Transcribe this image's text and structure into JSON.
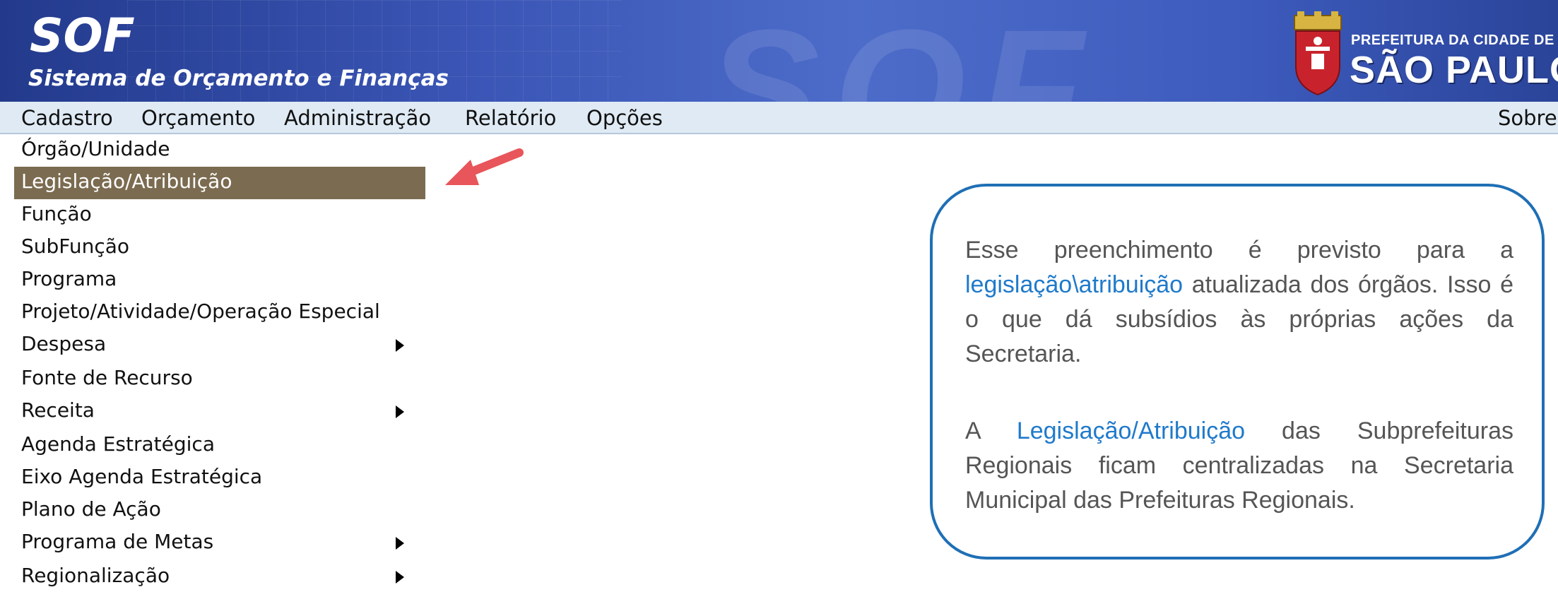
{
  "header": {
    "app_name": "SOF",
    "app_subtitle": "Sistema de Orçamento e Finanças",
    "watermark": "SOF",
    "logo": {
      "line1": "PREFEITURA DA CIDADE DE",
      "line2": "SÃO PAULO",
      "icon": "city-coat-of-arms-icon"
    }
  },
  "menubar": {
    "items": [
      "Cadastro",
      "Orçamento",
      "Administração",
      "Relatório",
      "Opções"
    ],
    "right_item": "Sobre"
  },
  "dropdown": {
    "items": [
      {
        "label": "Órgão/Unidade",
        "submenu": false
      },
      {
        "label": "Legislação/Atribuição",
        "submenu": false,
        "highlighted": true
      },
      {
        "label": "Função",
        "submenu": false
      },
      {
        "label": "SubFunção",
        "submenu": false
      },
      {
        "label": "Programa",
        "submenu": false
      },
      {
        "label": "Projeto/Atividade/Operação Especial",
        "submenu": false
      },
      {
        "label": "Despesa",
        "submenu": true
      },
      {
        "label": "Fonte de Recurso",
        "submenu": false
      },
      {
        "label": "Receita",
        "submenu": true
      },
      {
        "label": "Agenda Estratégica",
        "submenu": false
      },
      {
        "label": "Eixo Agenda Estratégica",
        "submenu": false
      },
      {
        "label": "Plano de Ação",
        "submenu": false
      },
      {
        "label": "Programa de Metas",
        "submenu": true
      },
      {
        "label": "Regionalização",
        "submenu": true
      }
    ]
  },
  "callout": {
    "p1_a": "Esse preenchimento é previsto para a ",
    "p1_link": "legislação\\atribuição",
    "p1_b": " atualizada dos órgãos. Isso é o que dá subsídios às próprias ações da Secretaria.",
    "p2_a": "A ",
    "p2_link": "Legislação/Atribuição",
    "p2_b": " das Subprefeituras Regionais ficam centralizadas na Secretaria Municipal das Prefeituras Regionais."
  },
  "colors": {
    "header_blue": "#3a55b5",
    "menubar_bg": "#dfeaf4",
    "highlight_bg": "#7b6b50",
    "arrow_red": "#e8555a",
    "callout_border": "#1f6fb5",
    "callout_link": "#1f7acb"
  },
  "icons": [
    "submenu-arrow-icon",
    "annotation-arrow-icon",
    "city-coat-of-arms-icon"
  ]
}
